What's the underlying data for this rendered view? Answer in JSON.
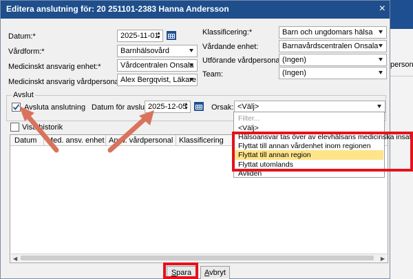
{
  "dialog": {
    "title": "Editera anslutning för: 20 251101-2383 Hanna Andersson",
    "close_symbol": "×"
  },
  "form": {
    "datum_label": "Datum:*",
    "datum_value": "2025-11-01",
    "vardform_label": "Vårdform:*",
    "vardform_value": "Barnhälsovård",
    "med_enhet_label": "Medicinskt ansvarig enhet:*",
    "med_enhet_value": "Vårdcentralen Onsala",
    "med_personal_label": "Medicinskt ansvarig vårdpersonal:",
    "med_personal_value": "Alex Bergqvist, Läkare",
    "klassificering_label": "Klassificering:*",
    "klassificering_value": "Barn och ungdomars hälsa",
    "vardande_enhet_label": "Vårdande enhet:",
    "vardande_enhet_value": "Barnavårdscentralen Onsala",
    "utforande_label": "Utförande vårdpersonal:",
    "utforande_value": "(Ingen)",
    "team_label": "Team:",
    "team_value": "(Ingen)"
  },
  "avslut": {
    "group_title": "Avslut",
    "checkbox_label": "Avsluta anslutning",
    "checkbox_checked": true,
    "datum_label": "Datum för avslut:",
    "datum_value": "2025-12-05",
    "orsak_label": "Orsak:",
    "orsak_value": "<Välj>"
  },
  "history": {
    "checkbox_label": "Visa historik",
    "columns": [
      "Datum",
      "Med. ansv. enhet",
      "Ansv. vårdpersonal",
      "Klassificering"
    ]
  },
  "dropdown": {
    "filter_placeholder": "Filter...",
    "items": [
      "<Välj>",
      "Hälsoansvar tas över av elevhälsans medicinska insats",
      "Flyttat till annan vårdenhet inom regionen",
      "Flyttat till annan region",
      "Flyttat utomlands",
      "Avliden"
    ],
    "highlighted_index": 3
  },
  "buttons": {
    "save_prefix": "S",
    "save_rest": "para",
    "cancel_prefix": "A",
    "cancel_rest": "vbryt"
  },
  "background": {
    "partial_text": "person"
  },
  "colors": {
    "titlebar": "#1e4e8c",
    "highlight": "#ffe48a",
    "annotation_red": "#e3121b"
  }
}
